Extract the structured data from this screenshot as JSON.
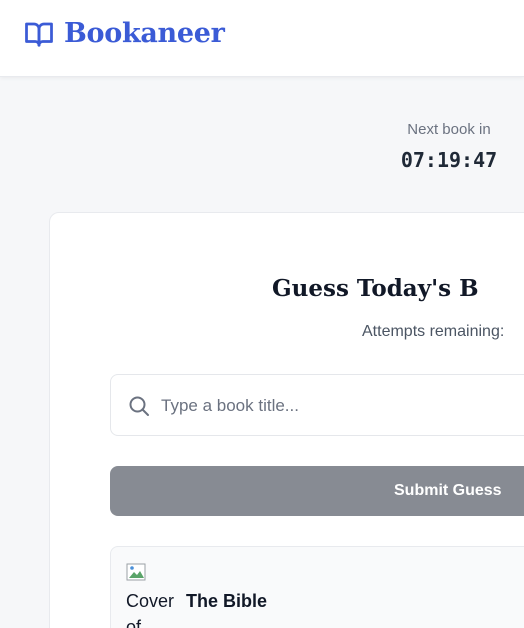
{
  "app": {
    "name": "Bookaneer",
    "logo_icon": "open-book-icon",
    "accent": "#3b5bd6"
  },
  "timer": {
    "label": "Next book in",
    "value": "07:19:47"
  },
  "game": {
    "title": "Guess Today's B",
    "attempts_label": "Attempts remaining:",
    "search_placeholder": "Type a book title...",
    "search_value": "",
    "submit_label": "Submit Guess",
    "submit_color": "#878b93"
  },
  "result": {
    "cover_alt": "Cover of",
    "title": "The Bible"
  }
}
